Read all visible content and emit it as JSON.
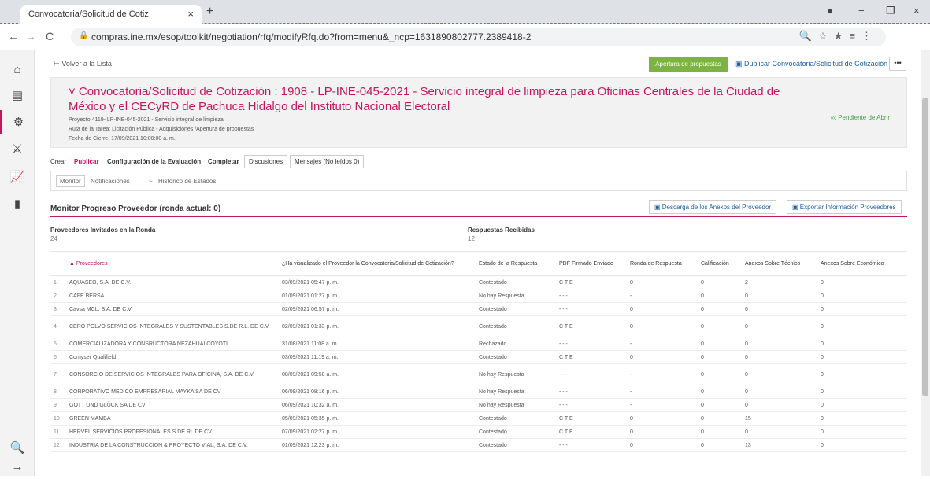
{
  "browser": {
    "tab_title": "Convocatoria/Solicitud de Cotiz",
    "tab_close": "×",
    "new_tab": "+",
    "url": "compras.ine.mx/esop/toolkit/negotiation/rfq/modifyRfq.do?from=menu&_ncp=1631890802777.2389418-2",
    "back": "←",
    "forward": "→",
    "reload": "C",
    "minimize": "−",
    "maximize": "❐",
    "close": "×",
    "profile": "●",
    "omni_icons": "🔍☆★≡⋮"
  },
  "rail": {
    "icons": [
      "⌂",
      "▤",
      "⚙",
      "⚔",
      "📈",
      "▮",
      "🔍",
      "→"
    ]
  },
  "toolbar": {
    "back_label": "⊢ Volver a la Lista",
    "open_proposals": "Apertura de propuestas",
    "duplicate": "▣ Duplicar Convocatoria/Solicitud de Cotización",
    "more": "•••"
  },
  "header": {
    "title": "˅ Convocatoria/Solicitud de Cotización : 1908 - LP-INE-045-2021 - Servicio integral de limpieza para Oficinas Centrales de la Ciudad de México y el CECyRD de Pachuca Hidalgo del Instituto Nacional Electoral",
    "status": "◎ Pendiente de Abrir",
    "project": "Proyecto:4119- LP-INE-045-2021 - Servicio integral de limpieza",
    "route": "Ruta de la Tarea: Licitación Pública - Adquisiciones /Apertura de propuestas",
    "closing": "Fecha de Cierre: 17/09/2021 10:00:00 a. m."
  },
  "tabs": {
    "crear": "Crear",
    "publicar": "Publicar",
    "config": "Configuración de la Evaluación",
    "completar": "Completar",
    "discusiones": "Discusiones",
    "mensajes": "Mensajes (No leídos 0)"
  },
  "subtabs": {
    "monitor": "Monitor",
    "notificaciones": "Notificaciones",
    "historico": "Histórico de Estados",
    "sep": "~"
  },
  "section": {
    "title": "Monitor Progreso Proveedor (ronda actual: 0)",
    "download_annex": "▣ Descarga de los Anexos del Proveedor",
    "export_info": "▣ Exportar Información Proveedores"
  },
  "stats": {
    "invited_label": "Proveedores Invitados en la Ronda",
    "invited_value": "24",
    "received_label": "Respuestas Recibidas",
    "received_value": "12"
  },
  "table": {
    "headers": [
      "",
      "▲ Proveedores",
      "¿Ha visualizado el Proveedor la Convocatoria/Solicitud de Cotización?",
      "Estado de la Respuesta",
      "PDF Firmado Enviado",
      "Ronda de Respuesta",
      "Calificación",
      "Anexos Sobre Técnico",
      "Anexos Sobre Económico"
    ],
    "rows": [
      [
        "1",
        "AQUASEO, S.A. DE C.V.",
        "03/09/2021 05:47 p. m.",
        "Contestado",
        "C T E",
        "0",
        "0",
        "2",
        "0"
      ],
      [
        "2",
        "CAFE BERSA",
        "01/09/2021 01:27 p. m.",
        "No hay Respuesta",
        "- - -",
        "-",
        "0",
        "0",
        "0"
      ],
      [
        "3",
        "Cavsa MCL, S.A. DE C.V.",
        "02/09/2021 06:57 p. m.",
        "Contestado",
        "- - -",
        "0",
        "0",
        "6",
        "0"
      ],
      [
        "4",
        "CERO POLVO SERVICIOS INTEGRALES Y SUSTENTABLES S.DE R.L. DE C.V",
        "02/09/2021 01:33 p. m.",
        "Contestado",
        "C T E",
        "0",
        "0",
        "0",
        "0"
      ],
      [
        "5",
        "COMERCIALIZADORA Y CONSRUCTORA NEZAHUALCOYOTL",
        "31/08/2021 11:08 a. m.",
        "Rechazado",
        "- - -",
        "-",
        "0",
        "0",
        "0"
      ],
      [
        "6",
        "Comyser Qualifield",
        "03/09/2021 11:19 a. m.",
        "Contestado",
        "C T E",
        "0",
        "0",
        "0",
        "0"
      ],
      [
        "7",
        "CONSORCIO DE SERVICIOS INTEGRALES PARA OFICINA, S.A. DE C.V.",
        "08/09/2021 09:58 a. m.",
        "No hay Respuesta",
        "- - -",
        "-",
        "0",
        "0",
        "0"
      ],
      [
        "8",
        "CORPORATIVO MEDICO EMPRESARIAL MAYKA SA DE CV",
        "06/09/2021 08:16 p. m.",
        "No hay Respuesta",
        "- - -",
        "-",
        "0",
        "0",
        "0"
      ],
      [
        "9",
        "GOTT UND GLÜCK SA DE CV",
        "06/09/2021 10:32 a. m.",
        "No hay Respuesta",
        "- - -",
        "-",
        "0",
        "0",
        "0"
      ],
      [
        "10",
        "GREEN MAMBA",
        "05/09/2021 05:35 p. m.",
        "Contestado",
        "C T E",
        "0",
        "0",
        "15",
        "0"
      ],
      [
        "11",
        "HERVEL SERVICIOS PROFESIONALES S DE RL DE CV",
        "07/09/2021 02:27 p. m.",
        "Contestado",
        "C T E",
        "0",
        "0",
        "0",
        "0"
      ],
      [
        "12",
        "INDUSTRIA DE LA CONSTRUCCION & PROYECTO VIAL, S.A. DE C.V.",
        "01/09/2021 12:23 p. m.",
        "Contestado",
        "- - -",
        "0",
        "0",
        "13",
        "0"
      ]
    ]
  }
}
